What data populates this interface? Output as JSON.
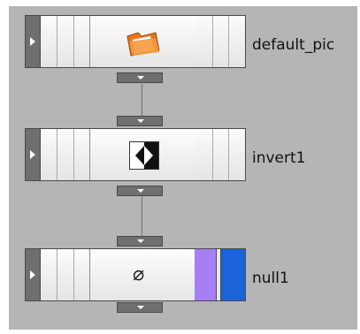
{
  "nodes": [
    {
      "label": "default_pic",
      "icon": "folder-icon"
    },
    {
      "label": "invert1",
      "icon": "invert-icon"
    },
    {
      "label": "null1",
      "icon": "null-icon",
      "glyph": "⌀",
      "flag_colors": [
        "#a77ff5",
        "#1a63d8"
      ]
    }
  ]
}
